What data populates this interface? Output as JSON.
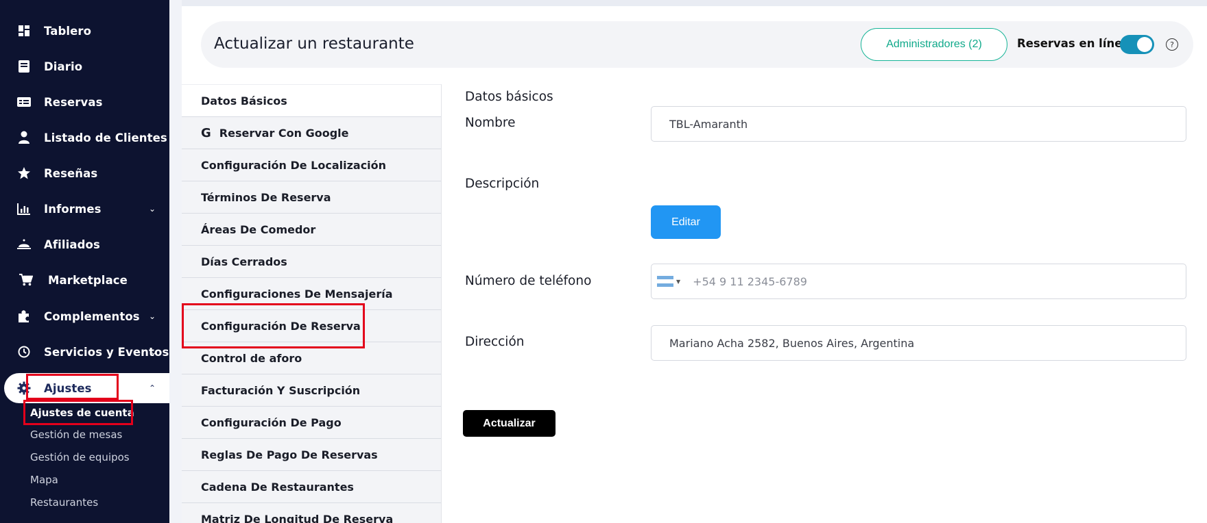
{
  "sidebar": {
    "items": [
      {
        "label": "Tablero",
        "icon": "dashboard-icon"
      },
      {
        "label": "Diario",
        "icon": "book-icon"
      },
      {
        "label": "Reservas",
        "icon": "reservations-icon"
      },
      {
        "label": "Listado de Clientes",
        "icon": "user-icon"
      },
      {
        "label": "Reseñas",
        "icon": "star-icon"
      },
      {
        "label": "Informes",
        "icon": "chart-icon",
        "chevron": "⌄"
      },
      {
        "label": "Afiliados",
        "icon": "bell-icon"
      },
      {
        "label": "Marketplace",
        "icon": "cart-icon"
      },
      {
        "label": "Complementos",
        "icon": "puzzle-icon",
        "chevron": "⌄"
      },
      {
        "label": "Servicios y Eventos",
        "icon": "clock-icon",
        "chevron": "⌄"
      },
      {
        "label": "Ajustes",
        "icon": "gear-icon",
        "chevron": "⌃"
      }
    ],
    "subitems": [
      {
        "label": "Ajustes de cuenta"
      },
      {
        "label": "Gestión de mesas"
      },
      {
        "label": "Gestión de equipos"
      },
      {
        "label": "Mapa"
      },
      {
        "label": "Restaurantes"
      }
    ]
  },
  "header": {
    "title": "Actualizar un restaurante",
    "admin_button": "Administradores (2)",
    "online_label": "Reservas en línea",
    "help": "?"
  },
  "menu": {
    "items": [
      {
        "label": "Datos Básicos"
      },
      {
        "label": "Reservar Con Google",
        "icon": "G"
      },
      {
        "label": "Configuración De Localización"
      },
      {
        "label": "Términos De Reserva"
      },
      {
        "label": "Áreas De Comedor"
      },
      {
        "label": "Días Cerrados"
      },
      {
        "label": "Configuraciones De Mensajería"
      },
      {
        "label": "Configuración De Reserva"
      },
      {
        "label": "Control de aforo"
      },
      {
        "label": "Facturación Y Suscripción"
      },
      {
        "label": "Configuración De Pago"
      },
      {
        "label": "Reglas De Pago De Reservas"
      },
      {
        "label": "Cadena De Restaurantes"
      },
      {
        "label": "Matriz De Longitud De Reserva"
      }
    ]
  },
  "form": {
    "section_title": "Datos básicos",
    "name_label": "Nombre",
    "name_value": "TBL-Amaranth",
    "description_label": "Descripción",
    "edit_button": "Editar",
    "phone_label": "Número de teléfono",
    "phone_placeholder": "+54 9 11 2345-6789",
    "address_label": "Dirección",
    "address_value": "Mariano Acha 2582, Buenos Aires, Argentina",
    "update_button": "Actualizar"
  },
  "colors": {
    "sidebar_bg": "#0d1330",
    "accent_green": "#16b497",
    "toggle_blue": "#1691b8",
    "edit_blue": "#2196f3",
    "highlight_red": "#e3001b"
  }
}
